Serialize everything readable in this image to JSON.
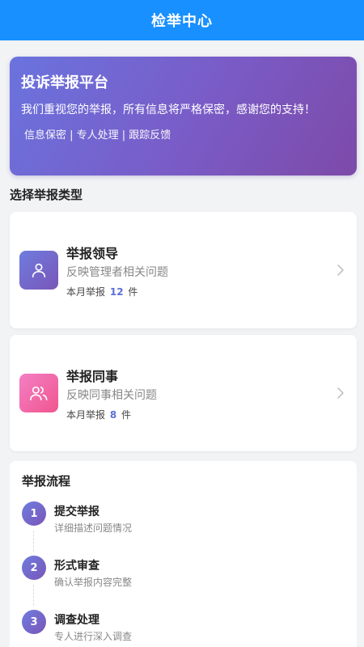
{
  "header": {
    "title": "检举中心"
  },
  "banner": {
    "title": "投诉举报平台",
    "description": "我们重视您的举报，所有信息将严格保密，感谢您的支持！",
    "tags": "信息保密 | 专人处理 | 跟踪反馈"
  },
  "section": {
    "title": "选择举报类型"
  },
  "report_types": [
    {
      "title": "举报领导",
      "description": "反映管理者相关问题",
      "count_prefix": "本月举报",
      "count": "12",
      "count_suffix": "件",
      "icon": "user-icon"
    },
    {
      "title": "举报同事",
      "description": "反映同事相关问题",
      "count_prefix": "本月举报",
      "count": "8",
      "count_suffix": "件",
      "icon": "users-icon"
    }
  ],
  "process": {
    "title": "举报流程",
    "steps": [
      {
        "num": "1",
        "title": "提交举报",
        "description": "详细描述问题情况"
      },
      {
        "num": "2",
        "title": "形式审查",
        "description": "确认举报内容完整"
      },
      {
        "num": "3",
        "title": "调查处理",
        "description": "专人进行深入调查"
      }
    ]
  },
  "colors": {
    "primary": "#1890ff",
    "accent": "#5b6fd6",
    "purple": "#7a55b8",
    "pink": "#f0568f"
  }
}
